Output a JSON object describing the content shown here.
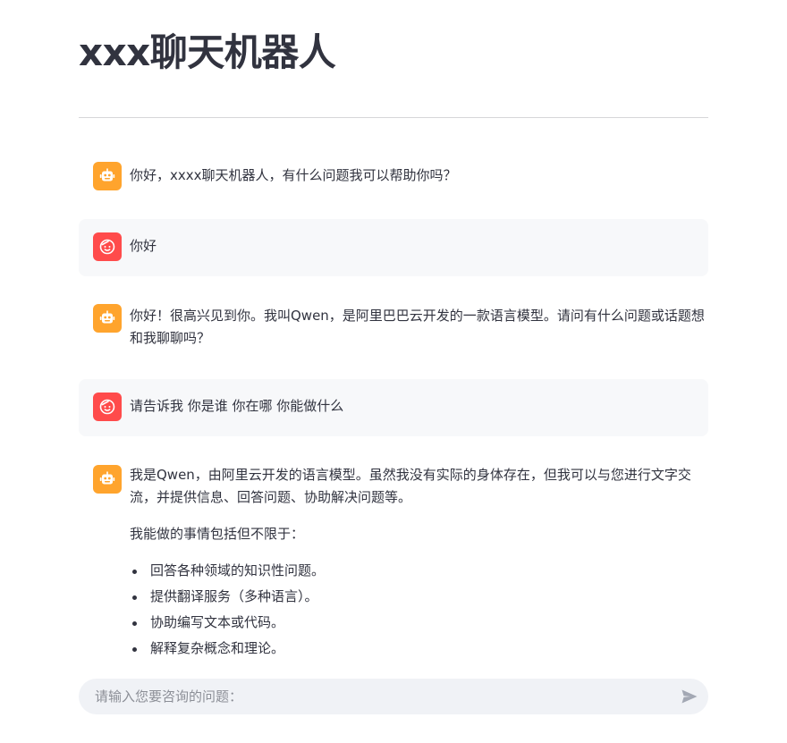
{
  "page": {
    "title": "xxx聊天机器人"
  },
  "messages": [
    {
      "role": "assistant",
      "paragraphs": [
        "你好，xxxx聊天机器人，有什么问题我可以帮助你吗？"
      ]
    },
    {
      "role": "user",
      "paragraphs": [
        "你好"
      ]
    },
    {
      "role": "assistant",
      "paragraphs": [
        "你好！很高兴见到你。我叫Qwen，是阿里巴巴云开发的一款语言模型。请问有什么问题或话题想和我聊聊吗？"
      ]
    },
    {
      "role": "user",
      "paragraphs": [
        "请告诉我 你是谁 你在哪 你能做什么"
      ]
    },
    {
      "role": "assistant",
      "paragraphs": [
        "我是Qwen，由阿里云开发的语言模型。虽然我没有实际的身体存在，但我可以与您进行文字交流，并提供信息、回答问题、协助解决问题等。",
        "我能做的事情包括但不限于："
      ],
      "bullets": [
        "回答各种领域的知识性问题。",
        "提供翻译服务（多种语言）。",
        "协助编写文本或代码。",
        "解释复杂概念和理论。"
      ]
    }
  ],
  "chat_input": {
    "placeholder": "请输入您要咨询的问题："
  },
  "icons": {
    "assistant_avatar": "robot-icon",
    "user_avatar": "smiley-face-icon",
    "send": "send-arrow-icon"
  },
  "colors": {
    "assistant_avatar_bg": "#ffa42d",
    "user_avatar_bg": "#ff4b4b",
    "user_message_bg": "#f7f8fa",
    "input_bg": "#f0f2f6"
  }
}
